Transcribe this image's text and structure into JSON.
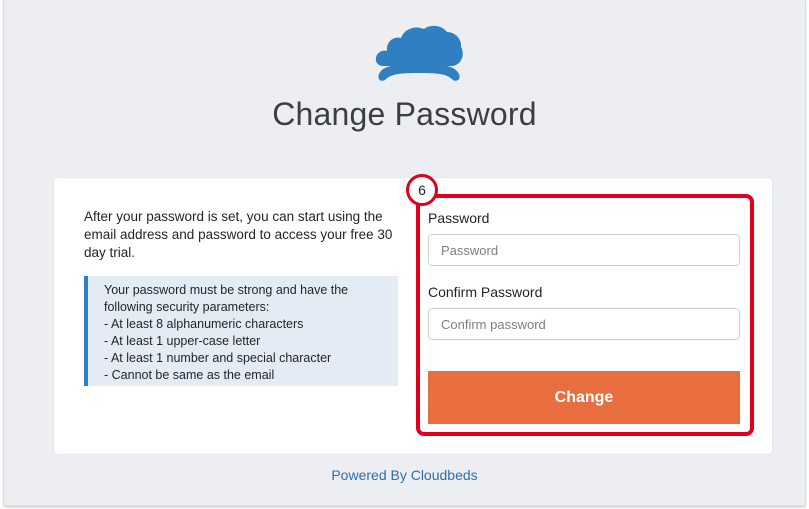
{
  "page": {
    "title": "Change Password"
  },
  "logo": {
    "icon": "cloud-bed-logo-icon",
    "color": "#2f7fc1"
  },
  "intro": {
    "text": "After your password is set, you can start using the email address and password to access your free 30 day trial."
  },
  "notice": {
    "lines": [
      "Your password must be strong and have the",
      "following security parameters:",
      "- At least 8 alphanumeric characters",
      "- At least 1 upper-case letter",
      "- At least 1 number and special character",
      "- Cannot be same as the email"
    ]
  },
  "form": {
    "step_badge": "6",
    "password_label": "Password",
    "password_placeholder": "Password",
    "confirm_label": "Confirm Password",
    "confirm_placeholder": "Confirm password",
    "submit_label": "Change"
  },
  "footer": {
    "link_text": "Powered By Cloudbeds"
  },
  "colors": {
    "accent": "#e96e3f",
    "highlight": "#e0001b",
    "link": "#2f6fa5"
  }
}
